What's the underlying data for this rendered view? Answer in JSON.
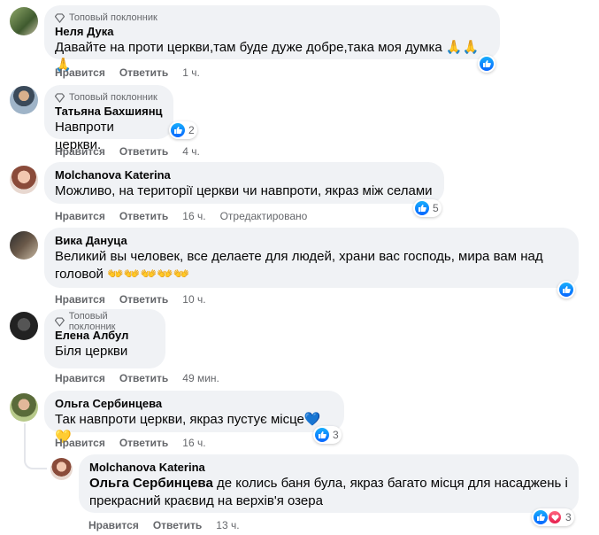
{
  "labels": {
    "like": "Нравится",
    "reply": "Ответить",
    "top_fan": "Топовый поклонник"
  },
  "comments": [
    {
      "author": "Неля Дука",
      "text": "Давайте на проти церкви,там буде дуже добре,така моя думка 🙏🙏🙏",
      "time": "1 ч.",
      "top_fan": true,
      "reactions": ""
    },
    {
      "author": "Татьяна Бахшиянц",
      "text": "Навпроти церкви.",
      "time": "4 ч.",
      "top_fan": true,
      "reactions": "2"
    },
    {
      "author": "Molchanova Katerina",
      "text": "Можливо, на території церкви чи навпроти, якраз між селами",
      "time": "16 ч.",
      "edited": "Отредактировано",
      "reactions": "5"
    },
    {
      "author": "Вика Дануца",
      "text_line1": "Великий вы человек, все делаете для людей, храни вас господь, мира вам над",
      "text_line2": "головой 👐👐👐👐👐",
      "time": "10 ч.",
      "reactions": ""
    },
    {
      "author": "Елена Албул",
      "text": "Біля церкви",
      "time": "49 мин.",
      "top_fan": true
    },
    {
      "author": "Ольга Сербинцева",
      "text": "Так навпроти церкви, якраз пустує місце💙💛",
      "time": "16 ч.",
      "reactions": "3"
    },
    {
      "author": "Molchanova Katerina",
      "mention": "Ольга Сербинцева",
      "text_line1": " де колись баня була, якраз багато місця для насаджень і",
      "text_line2": "прекрасний краєвид на верхів'я озера",
      "time": "13 ч.",
      "reactions": "3"
    }
  ],
  "colors": {
    "like_blue": "#0866ff",
    "bubble_bg": "#f0f2f5",
    "meta_gray": "#65676b"
  }
}
